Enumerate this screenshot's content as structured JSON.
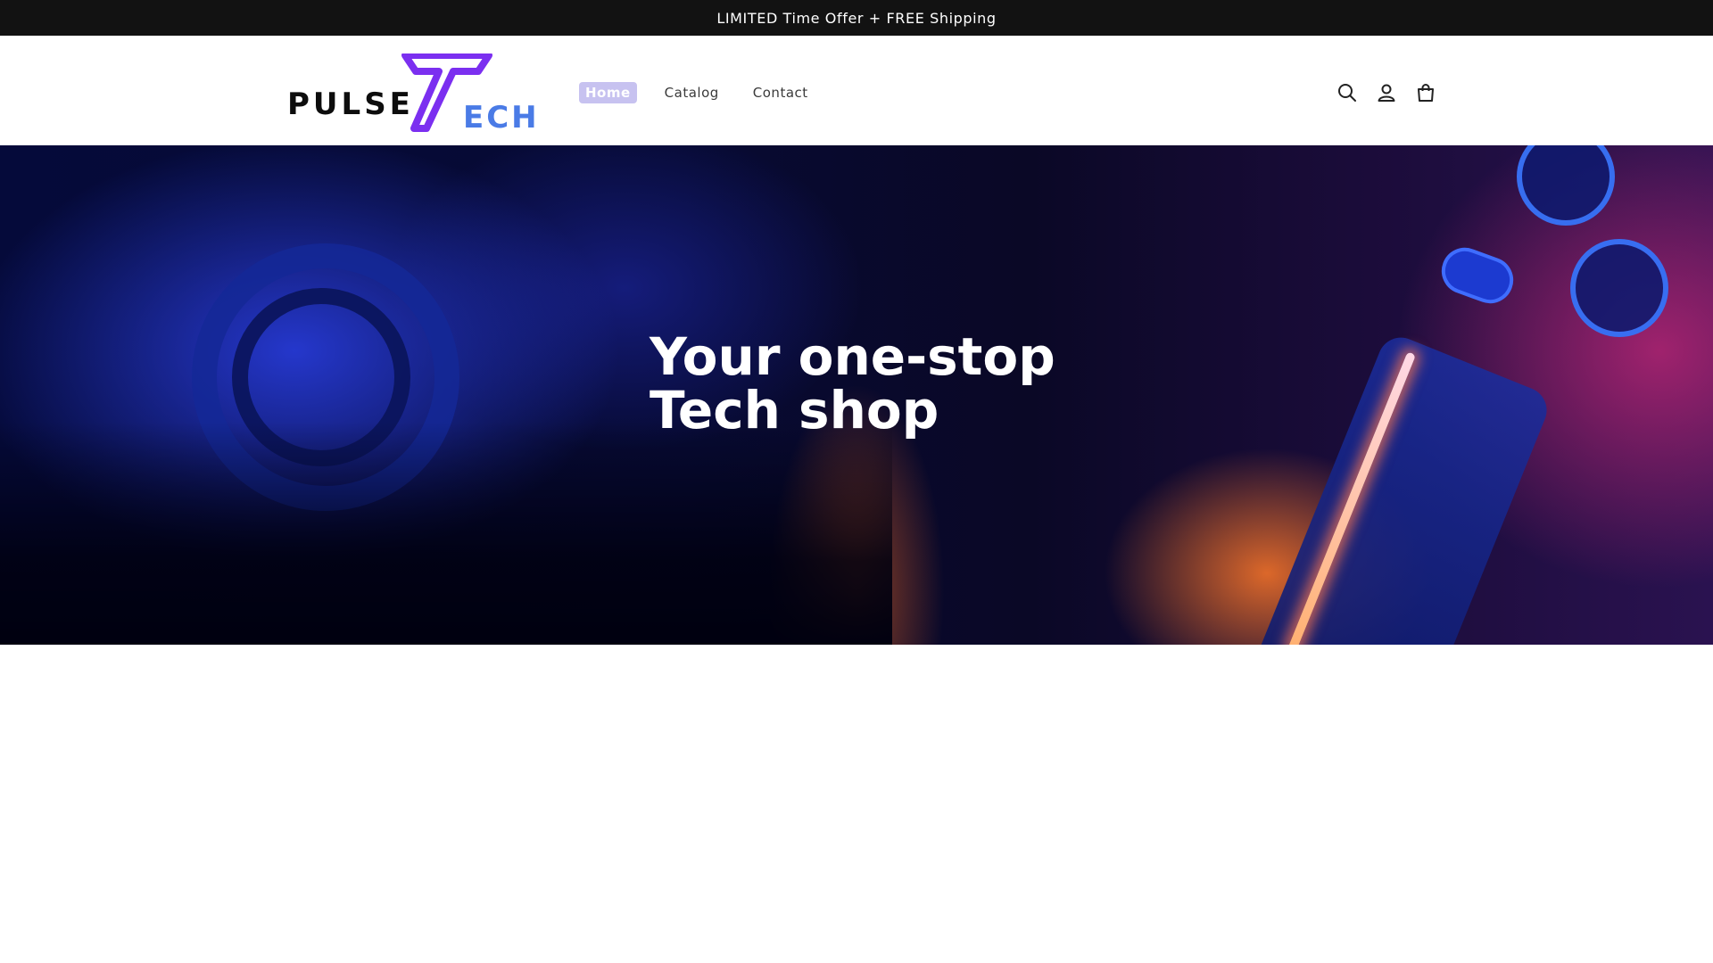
{
  "announcement": {
    "text": "LIMITED Time Offer + FREE Shipping"
  },
  "header": {
    "logo": {
      "word": "PULSE",
      "suffix": "ECH",
      "brand_purple": "#7b2ff0",
      "brand_blue": "#4a7be6"
    },
    "nav": [
      {
        "label": "Home",
        "active": true
      },
      {
        "label": "Catalog",
        "active": false
      },
      {
        "label": "Contact",
        "active": false
      }
    ],
    "icons": [
      "search-icon",
      "account-icon",
      "cart-icon"
    ]
  },
  "hero": {
    "title_line1": "Your one-stop",
    "title_line2": "Tech shop"
  },
  "colors": {
    "announcement_bg": "#121212",
    "nav_active_bg": "#c7c2f0"
  }
}
